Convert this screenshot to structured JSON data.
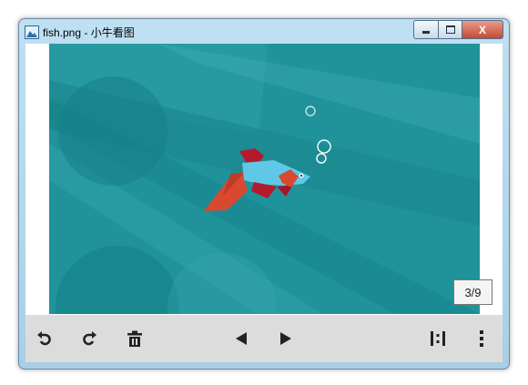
{
  "window": {
    "title": "fish.png - 小牛看图",
    "close_label": "X"
  },
  "viewer": {
    "image_name": "fish.png",
    "counter": "3/9"
  },
  "toolbar": {
    "buttons": [
      {
        "name": "rotate-left",
        "icon": "rotate-left-icon"
      },
      {
        "name": "rotate-right",
        "icon": "rotate-right-icon"
      },
      {
        "name": "delete",
        "icon": "trash-icon"
      },
      {
        "name": "previous",
        "icon": "triangle-left-icon"
      },
      {
        "name": "next",
        "icon": "triangle-right-icon"
      },
      {
        "name": "actual-size",
        "icon": "actual-size-icon"
      },
      {
        "name": "more",
        "icon": "more-vertical-icon"
      }
    ]
  },
  "colors": {
    "background_teal": "#20939a",
    "fish_body": "#5fc8e6",
    "fish_fin_red": "#b5192e",
    "fish_tail_orange": "#d9492f",
    "toolbar_bg": "#dcdcdc"
  }
}
